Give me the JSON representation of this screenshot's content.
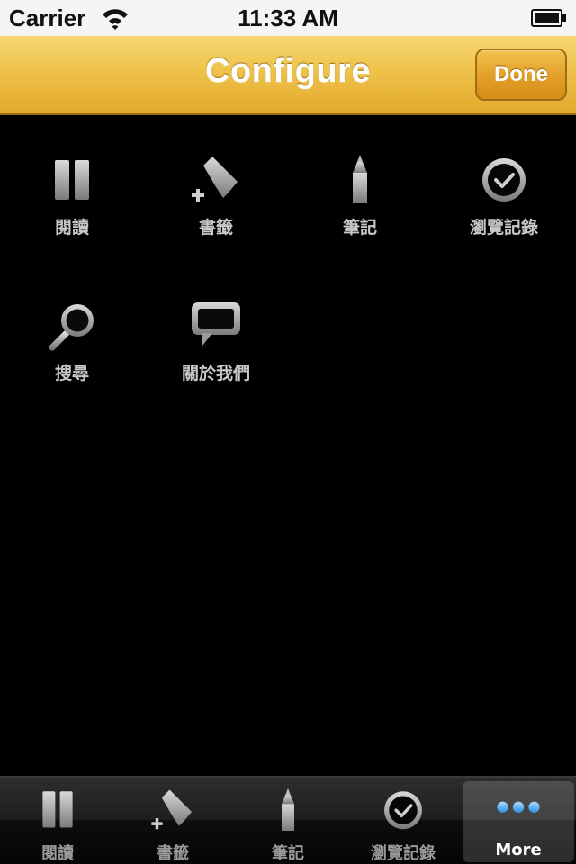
{
  "status_bar": {
    "carrier": "Carrier",
    "time": "11:33 AM",
    "wifi_icon": "wifi-icon",
    "battery_icon": "battery-full-icon"
  },
  "nav_bar": {
    "title": "Configure",
    "done_label": "Done",
    "accent_color": "#efc24a"
  },
  "configure_items": [
    {
      "label": "閱讀",
      "icon": "pause-icon"
    },
    {
      "label": "書籤",
      "icon": "add-bookmark-icon"
    },
    {
      "label": "筆記",
      "icon": "pen-icon"
    },
    {
      "label": "瀏覽記錄",
      "icon": "clock-icon"
    },
    {
      "label": "搜尋",
      "icon": "search-icon"
    },
    {
      "label": "關於我們",
      "icon": "speech-bubble-icon"
    }
  ],
  "tab_bar": {
    "items": [
      {
        "label": "閱讀",
        "icon": "pause-icon",
        "selected": false
      },
      {
        "label": "書籤",
        "icon": "add-bookmark-icon",
        "selected": false
      },
      {
        "label": "筆記",
        "icon": "pen-icon",
        "selected": false
      },
      {
        "label": "瀏覽記錄",
        "icon": "clock-icon",
        "selected": false
      },
      {
        "label": "More",
        "icon": "more-dots-icon",
        "selected": true
      }
    ],
    "selected_color": "#4aa8ff"
  }
}
